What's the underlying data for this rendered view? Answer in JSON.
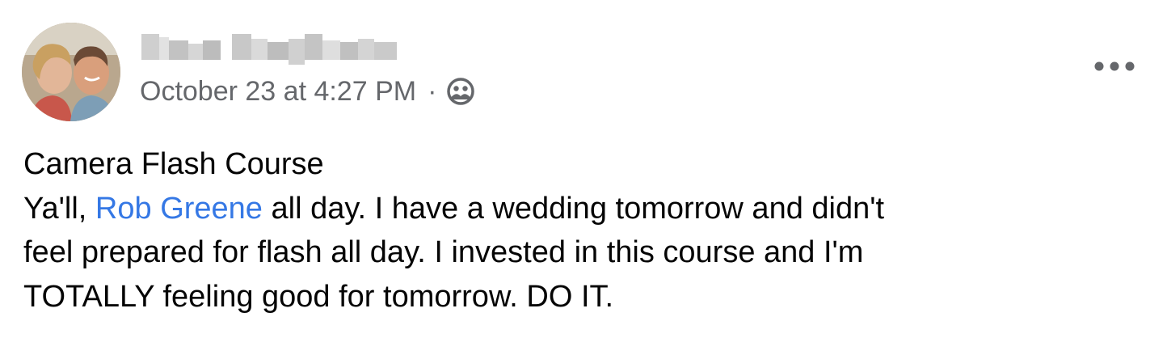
{
  "author": {
    "name_display": "blurred",
    "timestamp": "October 23 at 4:27 PM",
    "separator": "·",
    "audience_icon": "friends-icon"
  },
  "more_icon": "more-options-icon",
  "post": {
    "title": "Camera Flash Course",
    "line1_prefix": "Ya'll, ",
    "mention": "Rob Greene",
    "line1_suffix": " all day. I have a wedding tomorrow and didn't",
    "line2": "feel prepared for flash all day. I invested in this course and I'm",
    "line3": "TOTALLY feeling good for tomorrow. DO IT."
  },
  "colors": {
    "meta_text": "#65676b",
    "mention": "#3578e5",
    "body_text": "#050505"
  }
}
